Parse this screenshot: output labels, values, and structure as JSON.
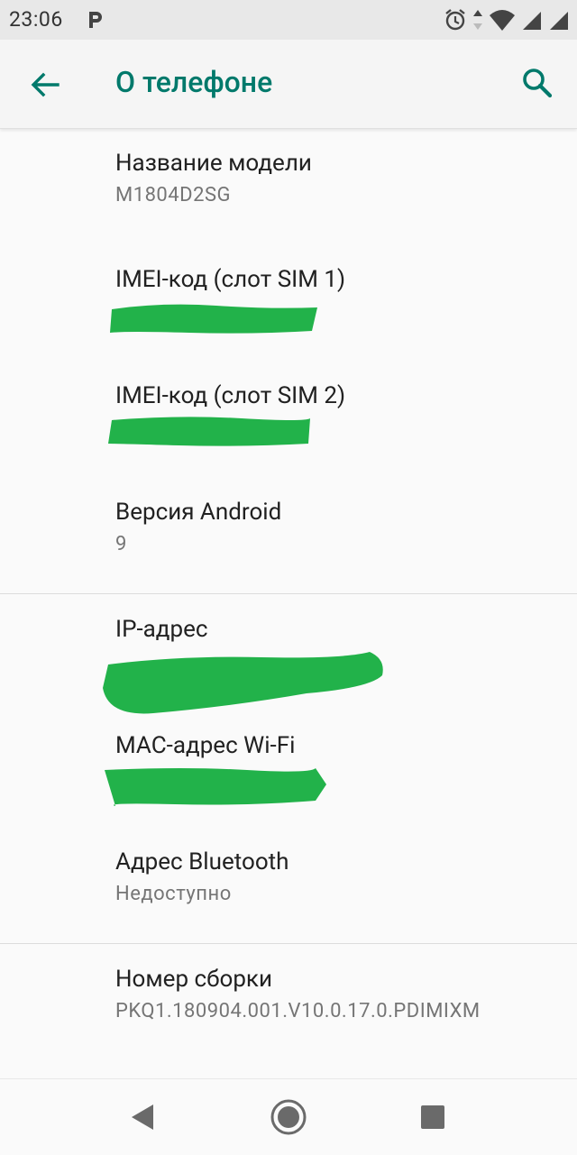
{
  "status_bar": {
    "time": "23:06",
    "icons": [
      "parking-p-icon",
      "alarm-icon",
      "data-arrows-icon",
      "wifi-icon",
      "signal-icon",
      "signal-2-icon"
    ]
  },
  "app_bar": {
    "title": "О телефоне",
    "back_icon": "arrow-back-icon",
    "search_icon": "search-icon",
    "accent_color": "#00796b"
  },
  "items": [
    {
      "title": "Название модели",
      "summary": "M1804D2SG",
      "redacted": false
    },
    {
      "title": "IMEI-код (слот SIM 1)",
      "summary": "",
      "redacted": true
    },
    {
      "title": "IMEI-код (слот SIM 2)",
      "summary": "",
      "redacted": true
    },
    {
      "title": "Версия Android",
      "summary": "9",
      "redacted": false
    },
    {
      "title": "IP-адрес",
      "summary": "",
      "redacted": true
    },
    {
      "title": "MAC-адрес Wi-Fi",
      "summary": "",
      "redacted": true
    },
    {
      "title": "Адрес Bluetooth",
      "summary": "Недоступно",
      "redacted": false
    },
    {
      "title": "Номер сборки",
      "summary": "PKQ1.180904.001.V10.0.17.0.PDIMIXM",
      "redacted": false
    }
  ],
  "redaction_color": "#22b24a",
  "nav_bar": {
    "buttons": [
      "back-triangle-icon",
      "home-circle-icon",
      "recents-square-icon"
    ]
  }
}
